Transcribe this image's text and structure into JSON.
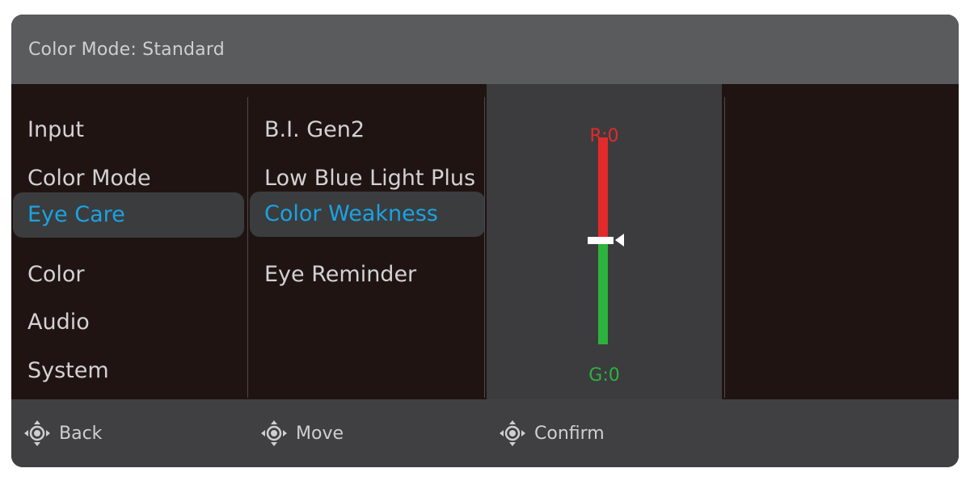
{
  "header": {
    "title": "Color Mode: Standard"
  },
  "menu": {
    "items": [
      {
        "label": "Input"
      },
      {
        "label": "Color Mode"
      },
      {
        "label": "Eye Care"
      },
      {
        "label": "Color"
      },
      {
        "label": "Audio"
      },
      {
        "label": "System"
      }
    ],
    "selected_index": 2
  },
  "submenu": {
    "items": [
      {
        "label": "B.I. Gen2"
      },
      {
        "label": "Low Blue Light Plus"
      },
      {
        "label": "Color Weakness"
      },
      {
        "label": "Eye Reminder"
      }
    ],
    "selected_index": 2
  },
  "slider": {
    "top_label": "R:0",
    "bottom_label": "G:0",
    "value_fraction": 0.5
  },
  "footer": {
    "hints": [
      {
        "label": "Back",
        "icon": "joystick-icon"
      },
      {
        "label": "Move",
        "icon": "joystick-icon"
      },
      {
        "label": "Confirm",
        "icon": "joystick-icon"
      }
    ]
  },
  "colors": {
    "accent": "#1aa3e2",
    "header_bg": "#5a5b5d",
    "panel_bg": "#201412",
    "footer_bg": "#404042",
    "slider_bg": "#3c3c3e",
    "red": "#e42a2a",
    "green": "#2bb33e"
  }
}
